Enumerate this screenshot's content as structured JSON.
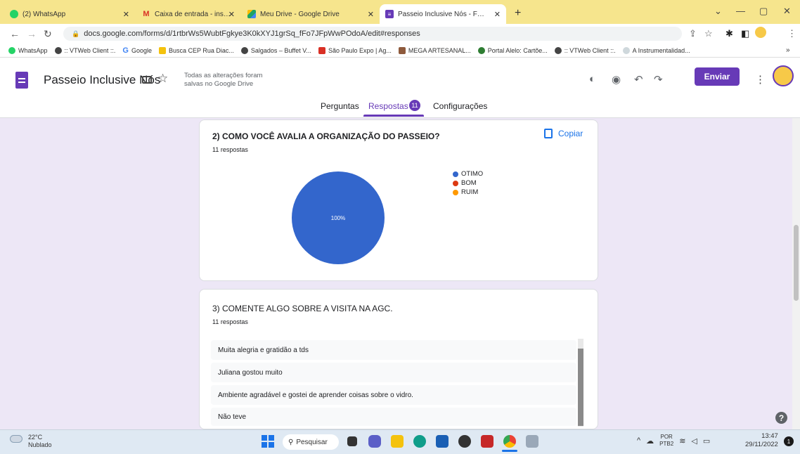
{
  "browser": {
    "tabs": [
      {
        "label": "(2) WhatsApp",
        "favicon": "whatsapp-icon",
        "color": "#25d366"
      },
      {
        "label": "Caixa de entrada - institutolucas",
        "favicon": "gmail-icon",
        "color": "#d93025"
      },
      {
        "label": "Meu Drive - Google Drive",
        "favicon": "drive-icon",
        "color": "#1fa463"
      },
      {
        "label": "Passeio Inclusive Nós - Formulári",
        "favicon": "forms-icon",
        "color": "#673ab7"
      }
    ],
    "url": "docs.google.com/forms/d/1rtbrWs5WubtFgkye3K0kXYJ1grSq_fFo7JFpWwPOdoA/edit#responses",
    "bookmarks": [
      "WhatsApp",
      ":: VTWeb Client ::.",
      "Google",
      "Busca CEP Rua Diac...",
      "Salgados – Buffet V...",
      "São Paulo Expo | Ag...",
      "MEGA ARTESANAL...",
      "Portal Alelo: Cartõe...",
      ":: VTWeb Client ::.",
      "A Instrumentalidad..."
    ],
    "bookmarks_more": "»"
  },
  "form": {
    "title": "Passeio Inclusive Nós",
    "saved_message": "Todas as alterações foram salvas no Google Drive",
    "send_label": "Enviar",
    "tabs": {
      "questions": "Perguntas",
      "responses": "Respostas",
      "responses_count": "11",
      "settings": "Configurações"
    }
  },
  "question2": {
    "title": "2) COMO VOCÊ AVALIA A ORGANIZAÇÃO DO PASSEIO?",
    "count": "11 respostas",
    "copy_label": "Copiar",
    "slice_label": "100%"
  },
  "chart_data": {
    "type": "pie",
    "categories": [
      "OTIMO",
      "BOM",
      "RUIM"
    ],
    "values": [
      100,
      0,
      0
    ],
    "colors": [
      "#3366cc",
      "#dc3912",
      "#ff9900"
    ],
    "legend": "right"
  },
  "question3": {
    "title": "3) COMENTE ALGO SOBRE A VISITA NA AGC.",
    "count": "11 respostas",
    "responses": [
      "Muita alegria e gratidão a tds",
      "Juliana gostou muito",
      "Ambiente agradável e gostei de aprender coisas sobre o vidro.",
      "Não teve"
    ]
  },
  "taskbar": {
    "temperature": "22°C",
    "weather": "Nublado",
    "search_label": "Pesquisar",
    "lang": "POR",
    "lang2": "PTB2",
    "time": "13:47",
    "date": "29/11/2022",
    "notifications": "1"
  }
}
